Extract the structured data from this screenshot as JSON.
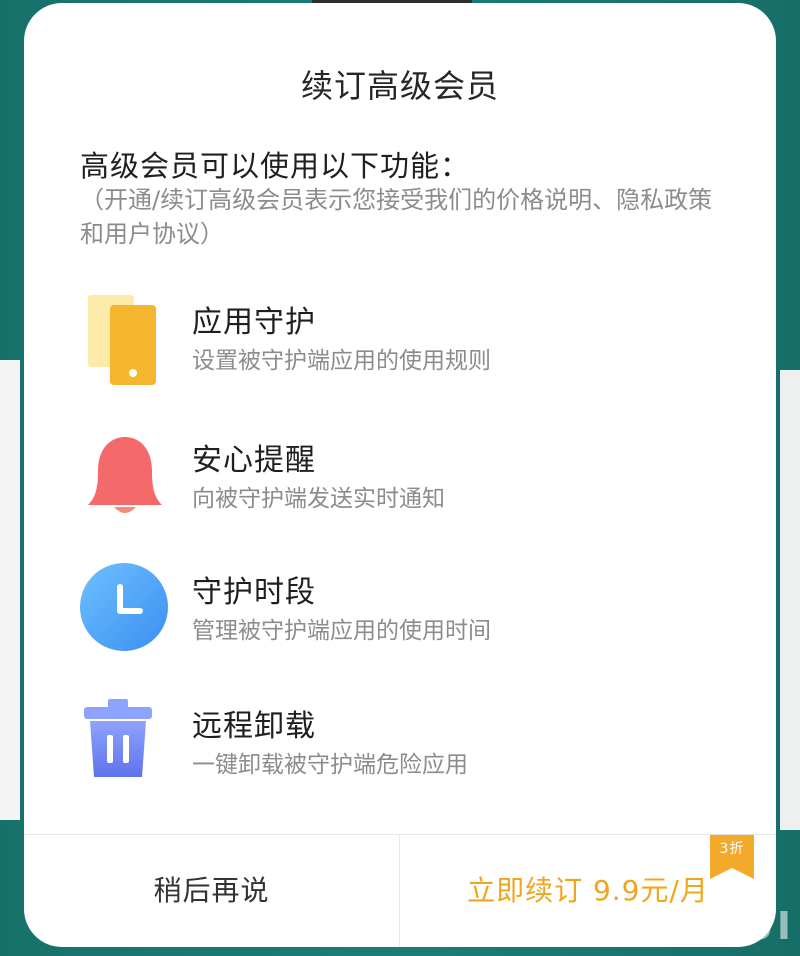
{
  "dialog": {
    "title": "续订高级会员",
    "intro_title": "高级会员可以使用以下功能：",
    "intro_note": "（开通/续订高级会员表示您接受我们的价格说明、隐私政策和用户协议）"
  },
  "features": [
    {
      "name": "应用守护",
      "desc": "设置被守护端应用的使用规则",
      "icon": "phone-icon"
    },
    {
      "name": "安心提醒",
      "desc": "向被守护端发送实时通知",
      "icon": "bell-icon"
    },
    {
      "name": "守护时段",
      "desc": "管理被守护端应用的使用时间",
      "icon": "clock-icon"
    },
    {
      "name": "远程卸载",
      "desc": "一键卸载被守护端危险应用",
      "icon": "trash-icon"
    }
  ],
  "footer": {
    "later_label": "稍后再说",
    "renew_label": "立即续订 9.9元/月",
    "discount_badge": "3折"
  },
  "watermark": "MIUI",
  "colors": {
    "accent": "#f0a51e",
    "background": "#1c7d77",
    "phone_icon": "#f5b52e",
    "bell_icon": "#f46a6a",
    "clock_icon": "#4da3f5",
    "trash_icon": "#6f7ff0"
  }
}
